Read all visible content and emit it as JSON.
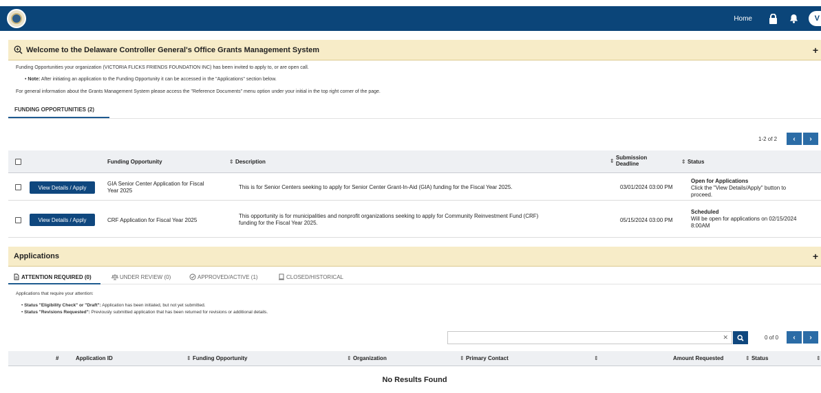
{
  "header": {
    "home_label": "Home",
    "avatar_initial": "V"
  },
  "welcome": {
    "title": "Welcome to the Delaware Controller General's Office Grants Management System",
    "intro": "Funding Opportunities your organization (VICTORIA FLICKS FRIENDS FOUNDATION INC) has been invited to apply to, or are open call.",
    "note_label": "Note:",
    "note_text": " After initiating an application to the Funding Opportunity it can be accessed in the \"Applications\" section below.",
    "general_info": "For general information about the Grants Management System please access the \"Reference Documents\" menu option under your initial in the top right corner of the page.",
    "expand_icon": "+"
  },
  "funding": {
    "tab_label": "FUNDING OPPORTUNITIES (2)",
    "pager_text": "1-2 of 2",
    "columns": {
      "opportunity": "Funding Opportunity",
      "description": "Description",
      "deadline_line1": "Submission",
      "deadline_line2": "Deadline",
      "status": "Status"
    },
    "rows": [
      {
        "button": "View Details / Apply",
        "name_line1": "GIA Senior Center Application for Fiscal",
        "name_line2": "Year 2025",
        "description": "This is for Senior Centers seeking to apply for Senior Center Grant-In-Aid (GIA) funding for the Fiscal Year 2025.",
        "deadline": "03/01/2024 03:00 PM",
        "status_title": "Open for Applications",
        "status_line1": "Click the \"View Details/Apply\" button to",
        "status_line2": "proceed."
      },
      {
        "button": "View Details / Apply",
        "name": "CRF Application for Fiscal Year 2025",
        "desc_line1": "This opportunity is for municipalities and nonprofit organizations seeking to apply for Community Reinvestment Fund (CRF)",
        "desc_line2": "funding for the Fiscal Year 2025.",
        "deadline": "05/15/2024 03:00 PM",
        "status_title": "Scheduled",
        "status_line1": "Will be open for applications on 02/15/2024",
        "status_line2": "8:00AM"
      }
    ]
  },
  "applications": {
    "title": "Applications",
    "expand_icon": "+",
    "tabs": [
      {
        "label": "ATTENTION REQUIRED (0)"
      },
      {
        "label": "UNDER REVIEW (0)"
      },
      {
        "label": "APPROVED/ACTIVE (1)"
      },
      {
        "label": "CLOSED/HISTORICAL"
      }
    ],
    "intro": "Applications that require your attention:",
    "bullet1_label": "Status \"Eligibility Check\" or \"Draft\":",
    "bullet1_text": " Application has been initiated, but not yet submitted.",
    "bullet2_label": "Status \"Revisions Requested\":",
    "bullet2_text": " Previously submitted application that has been returned for revisions or additional details.",
    "search_value": "",
    "pager_text": "0 of 0",
    "columns": {
      "number": "#",
      "app_id": "Application ID",
      "opportunity": "Funding Opportunity",
      "organization": "Organization",
      "contact": "Primary Contact",
      "amount": "Amount Requested",
      "status": "Status"
    },
    "no_results": "No Results Found"
  }
}
